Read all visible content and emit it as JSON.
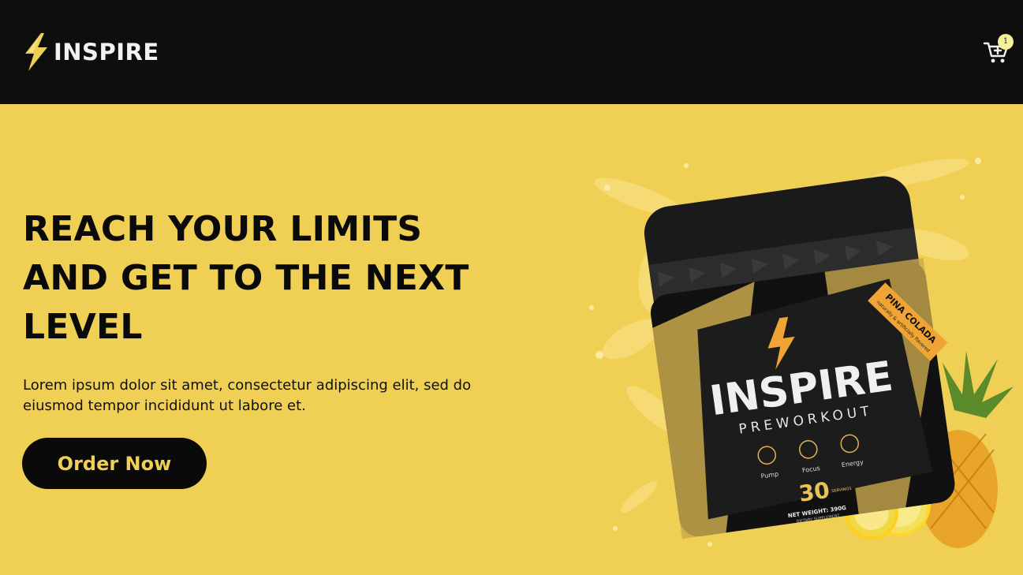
{
  "header": {
    "brand": "INSPIRE",
    "logo_icon": "lightning-bolt-icon",
    "cart_icon": "cart-plus-icon",
    "cart_count": "1"
  },
  "hero": {
    "headline": "REACH YOUR LIMITS AND GET TO THE NEXT LEVEL",
    "description": "Lorem ipsum dolor sit amet, consectetur adipiscing elit, sed do eiusmod tempor incididunt ut labore et.",
    "cta_label": "Order Now"
  },
  "product": {
    "brand": "INSPIRE",
    "line": "PREWORKOUT",
    "flavor": "PINA COLADA",
    "flavor_note": "naturally & artificially flavored",
    "features": [
      "Pump",
      "Focus",
      "Energy"
    ],
    "servings": "30",
    "servings_unit": "SERVINGS",
    "net_weight": "NET WEIGHT: 390G",
    "supplement": "DIETARY SUPPLEMENT"
  },
  "colors": {
    "nav_bg": "#0e0e0e",
    "hero_bg": "#f0cf55",
    "accent": "#f0cf55",
    "button_bg": "#0a0a0a",
    "badge_bg": "#f6ef9b"
  }
}
